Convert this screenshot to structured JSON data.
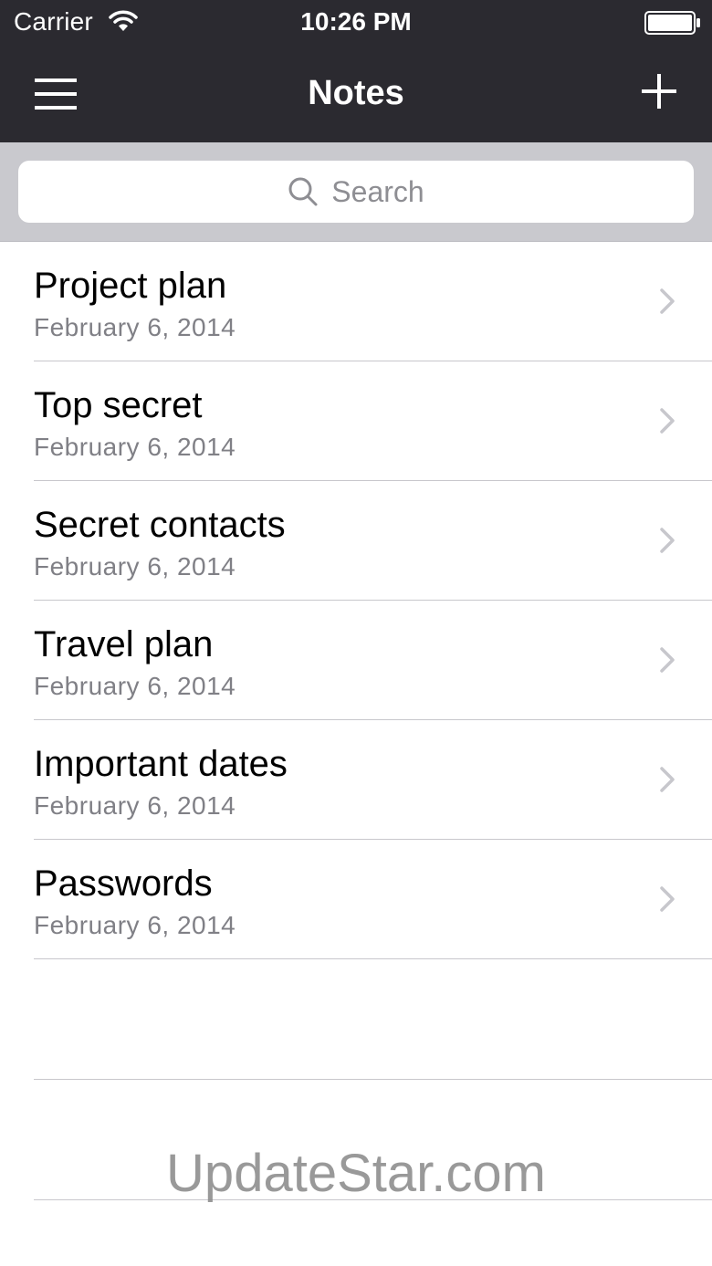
{
  "status_bar": {
    "carrier": "Carrier",
    "time": "10:26 PM",
    "wifi_icon": "wifi-icon",
    "battery_icon": "battery-full-icon"
  },
  "nav_bar": {
    "title": "Notes",
    "menu_icon": "hamburger-menu-icon",
    "add_icon": "plus-icon"
  },
  "search": {
    "placeholder": "Search",
    "icon": "search-icon"
  },
  "notes": [
    {
      "title": "Project plan",
      "date": "February 6, 2014"
    },
    {
      "title": "Top secret",
      "date": "February 6, 2014"
    },
    {
      "title": "Secret contacts",
      "date": "February 6, 2014"
    },
    {
      "title": "Travel plan",
      "date": "February 6, 2014"
    },
    {
      "title": "Important dates",
      "date": "February 6, 2014"
    },
    {
      "title": "Passwords",
      "date": "February 6, 2014"
    }
  ],
  "watermark": "UpdateStar.com",
  "colors": {
    "nav_background": "#2b2a30",
    "search_background": "#c9c9ce",
    "separator": "#c8c7cc",
    "date_text": "#808086",
    "chevron": "#c7c7cc"
  }
}
